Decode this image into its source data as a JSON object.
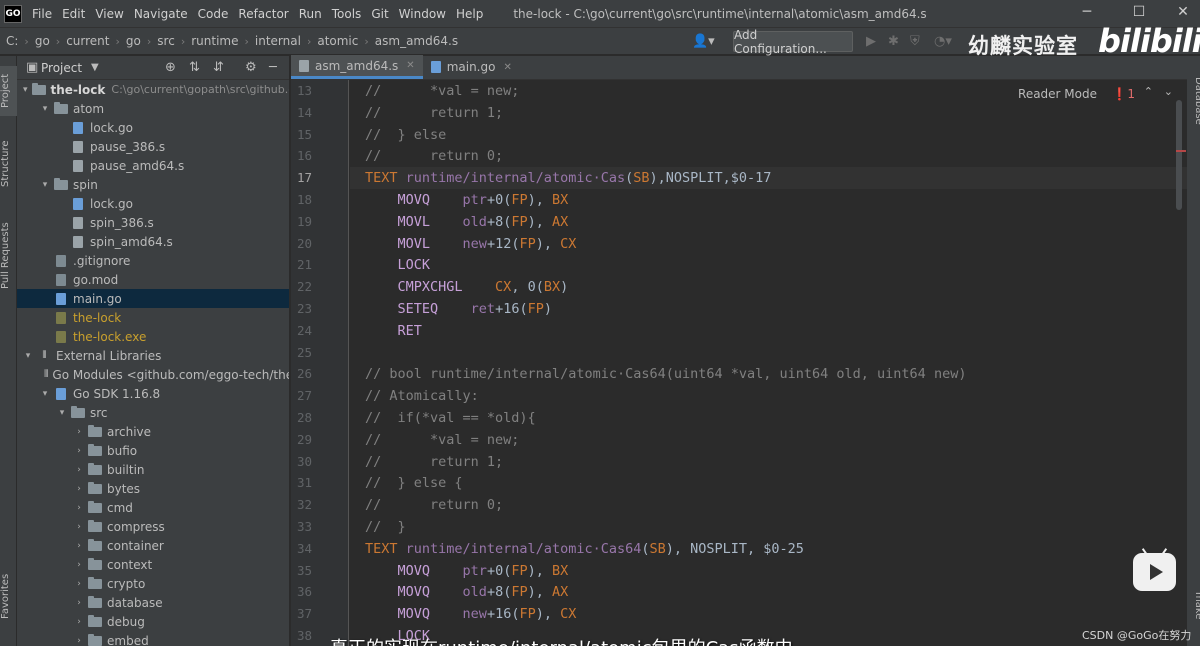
{
  "window": {
    "logo": "GO",
    "title": "the-lock - C:\\go\\current\\go\\src\\runtime\\internal\\atomic\\asm_amd64.s",
    "menu": [
      "File",
      "Edit",
      "View",
      "Navigate",
      "Code",
      "Refactor",
      "Run",
      "Tools",
      "Git",
      "Window",
      "Help"
    ]
  },
  "breadcrumb": [
    "C:",
    "go",
    "current",
    "go",
    "src",
    "runtime",
    "internal",
    "atomic",
    "asm_amd64.s"
  ],
  "toolbar": {
    "run_config_label": "Add Configuration...",
    "icons": [
      "user-icon",
      "run-icon",
      "debug-icon",
      "coverage-icon",
      "profile-icon"
    ]
  },
  "watermark": {
    "channel": "幼麟实验室",
    "site": "bilibili",
    "csdn": "CSDN @GoGo在努力"
  },
  "left_strip": [
    "Project",
    "Structure",
    "Pull Requests",
    "Favorites"
  ],
  "right_strip": [
    "Database",
    "make"
  ],
  "project_panel": {
    "title": "Project",
    "tree": [
      {
        "depth": 0,
        "arrow": "▾",
        "icon": "folder",
        "label": "the-lock",
        "path": "C:\\go\\current\\gopath\\src\\github.co",
        "bold": true
      },
      {
        "depth": 1,
        "arrow": "▾",
        "icon": "folder",
        "label": "atom"
      },
      {
        "depth": 2,
        "arrow": "",
        "icon": "go",
        "label": "lock.go"
      },
      {
        "depth": 2,
        "arrow": "",
        "icon": "s",
        "label": "pause_386.s"
      },
      {
        "depth": 2,
        "arrow": "",
        "icon": "s",
        "label": "pause_amd64.s"
      },
      {
        "depth": 1,
        "arrow": "▾",
        "icon": "folder",
        "label": "spin"
      },
      {
        "depth": 2,
        "arrow": "",
        "icon": "go",
        "label": "lock.go"
      },
      {
        "depth": 2,
        "arrow": "",
        "icon": "s",
        "label": "spin_386.s"
      },
      {
        "depth": 2,
        "arrow": "",
        "icon": "s",
        "label": "spin_amd64.s"
      },
      {
        "depth": 1,
        "arrow": "",
        "icon": "git",
        "label": ".gitignore"
      },
      {
        "depth": 1,
        "arrow": "",
        "icon": "mod",
        "label": "go.mod"
      },
      {
        "depth": 1,
        "arrow": "",
        "icon": "go",
        "label": "main.go",
        "selected": true
      },
      {
        "depth": 1,
        "arrow": "",
        "icon": "bin",
        "label": "the-lock",
        "yellow": true
      },
      {
        "depth": 1,
        "arrow": "",
        "icon": "bin",
        "label": "the-lock.exe",
        "yellow": true
      },
      {
        "depth": 0,
        "arrow": "▾",
        "icon": "lib",
        "label": "External Libraries"
      },
      {
        "depth": 1,
        "arrow": "",
        "icon": "lib",
        "label": "Go Modules <github.com/eggo-tech/the-l"
      },
      {
        "depth": 1,
        "arrow": "▾",
        "icon": "go",
        "label": "Go SDK 1.16.8"
      },
      {
        "depth": 2,
        "arrow": "▾",
        "icon": "folder",
        "label": "src"
      },
      {
        "depth": 3,
        "arrow": "›",
        "icon": "folder",
        "label": "archive"
      },
      {
        "depth": 3,
        "arrow": "›",
        "icon": "folder",
        "label": "bufio"
      },
      {
        "depth": 3,
        "arrow": "›",
        "icon": "folder",
        "label": "builtin"
      },
      {
        "depth": 3,
        "arrow": "›",
        "icon": "folder",
        "label": "bytes"
      },
      {
        "depth": 3,
        "arrow": "›",
        "icon": "folder",
        "label": "cmd"
      },
      {
        "depth": 3,
        "arrow": "›",
        "icon": "folder",
        "label": "compress"
      },
      {
        "depth": 3,
        "arrow": "›",
        "icon": "folder",
        "label": "container"
      },
      {
        "depth": 3,
        "arrow": "›",
        "icon": "folder",
        "label": "context"
      },
      {
        "depth": 3,
        "arrow": "›",
        "icon": "folder",
        "label": "crypto"
      },
      {
        "depth": 3,
        "arrow": "›",
        "icon": "folder",
        "label": "database"
      },
      {
        "depth": 3,
        "arrow": "›",
        "icon": "folder",
        "label": "debug"
      },
      {
        "depth": 3,
        "arrow": "›",
        "icon": "folder",
        "label": "embed"
      }
    ]
  },
  "tabs": [
    {
      "label": "asm_amd64.s",
      "icon": "s",
      "active": true
    },
    {
      "label": "main.go",
      "icon": "go",
      "active": false
    }
  ],
  "editor": {
    "reader_mode": "Reader Mode",
    "error_count": "❗1",
    "current_line": 17,
    "lines": [
      {
        "n": 13,
        "tokens": [
          [
            "c-comment",
            "//      *val = new;"
          ]
        ]
      },
      {
        "n": 14,
        "tokens": [
          [
            "c-comment",
            "//      return 1;"
          ]
        ]
      },
      {
        "n": 15,
        "tokens": [
          [
            "c-comment",
            "//  } else"
          ]
        ]
      },
      {
        "n": 16,
        "tokens": [
          [
            "c-comment",
            "//      return 0;"
          ]
        ]
      },
      {
        "n": 17,
        "tokens": [
          [
            "c-kw",
            "TEXT "
          ],
          [
            "c-sym",
            "runtime∕internal∕atomic·Cas"
          ],
          [
            "c-plain",
            "("
          ],
          [
            "c-sb",
            "SB"
          ],
          [
            "c-plain",
            "),NOSPLIT,$0-17"
          ]
        ]
      },
      {
        "n": 18,
        "tokens": [
          [
            "c-ins",
            "    MOVQ    "
          ],
          [
            "c-sym",
            "ptr"
          ],
          [
            "c-plain",
            "+0("
          ],
          [
            "c-sb",
            "FP"
          ],
          [
            "c-plain",
            "), "
          ],
          [
            "c-reg",
            "BX"
          ]
        ]
      },
      {
        "n": 19,
        "tokens": [
          [
            "c-ins",
            "    MOVL    "
          ],
          [
            "c-sym",
            "old"
          ],
          [
            "c-plain",
            "+8("
          ],
          [
            "c-sb",
            "FP"
          ],
          [
            "c-plain",
            "), "
          ],
          [
            "c-reg",
            "AX"
          ]
        ]
      },
      {
        "n": 20,
        "tokens": [
          [
            "c-ins",
            "    MOVL    "
          ],
          [
            "c-sym",
            "new"
          ],
          [
            "c-plain",
            "+12("
          ],
          [
            "c-sb",
            "FP"
          ],
          [
            "c-plain",
            "), "
          ],
          [
            "c-reg",
            "CX"
          ]
        ]
      },
      {
        "n": 21,
        "tokens": [
          [
            "c-ins",
            "    LOCK"
          ]
        ]
      },
      {
        "n": 22,
        "tokens": [
          [
            "c-ins",
            "    CMPXCHGL    "
          ],
          [
            "c-reg",
            "CX"
          ],
          [
            "c-plain",
            ", 0("
          ],
          [
            "c-reg",
            "BX"
          ],
          [
            "c-plain",
            ")"
          ]
        ]
      },
      {
        "n": 23,
        "tokens": [
          [
            "c-ins",
            "    SETEQ    "
          ],
          [
            "c-sym",
            "ret"
          ],
          [
            "c-plain",
            "+16("
          ],
          [
            "c-sb",
            "FP"
          ],
          [
            "c-plain",
            ")"
          ]
        ]
      },
      {
        "n": 24,
        "tokens": [
          [
            "c-ins",
            "    RET"
          ]
        ]
      },
      {
        "n": 25,
        "tokens": [
          [
            "c-plain",
            ""
          ]
        ]
      },
      {
        "n": 26,
        "tokens": [
          [
            "c-comment",
            "// bool runtime∕internal∕atomic·Cas64(uint64 *val, uint64 old, uint64 new)"
          ]
        ]
      },
      {
        "n": 27,
        "tokens": [
          [
            "c-comment",
            "// Atomically:"
          ]
        ]
      },
      {
        "n": 28,
        "tokens": [
          [
            "c-comment",
            "//  if(*val == *old){"
          ]
        ]
      },
      {
        "n": 29,
        "tokens": [
          [
            "c-comment",
            "//      *val = new;"
          ]
        ]
      },
      {
        "n": 30,
        "tokens": [
          [
            "c-comment",
            "//      return 1;"
          ]
        ]
      },
      {
        "n": 31,
        "tokens": [
          [
            "c-comment",
            "//  } else {"
          ]
        ]
      },
      {
        "n": 32,
        "tokens": [
          [
            "c-comment",
            "//      return 0;"
          ]
        ]
      },
      {
        "n": 33,
        "tokens": [
          [
            "c-comment",
            "//  }"
          ]
        ]
      },
      {
        "n": 34,
        "tokens": [
          [
            "c-kw",
            "TEXT "
          ],
          [
            "c-sym",
            "runtime∕internal∕atomic·Cas64"
          ],
          [
            "c-plain",
            "("
          ],
          [
            "c-sb",
            "SB"
          ],
          [
            "c-plain",
            "), NOSPLIT, $0-25"
          ]
        ]
      },
      {
        "n": 35,
        "tokens": [
          [
            "c-ins",
            "    MOVQ    "
          ],
          [
            "c-sym",
            "ptr"
          ],
          [
            "c-plain",
            "+0("
          ],
          [
            "c-sb",
            "FP"
          ],
          [
            "c-plain",
            "), "
          ],
          [
            "c-reg",
            "BX"
          ]
        ]
      },
      {
        "n": 36,
        "tokens": [
          [
            "c-ins",
            "    MOVQ    "
          ],
          [
            "c-sym",
            "old"
          ],
          [
            "c-plain",
            "+8("
          ],
          [
            "c-sb",
            "FP"
          ],
          [
            "c-plain",
            "), "
          ],
          [
            "c-reg",
            "AX"
          ]
        ]
      },
      {
        "n": 37,
        "tokens": [
          [
            "c-ins",
            "    MOVQ    "
          ],
          [
            "c-sym",
            "new"
          ],
          [
            "c-plain",
            "+16("
          ],
          [
            "c-sb",
            "FP"
          ],
          [
            "c-plain",
            "), "
          ],
          [
            "c-reg",
            "CX"
          ]
        ]
      },
      {
        "n": 38,
        "tokens": [
          [
            "c-ins",
            "    LOCK"
          ]
        ]
      }
    ]
  },
  "subtitle": "真正的实现在runtime/internal/atomic包里的Cas函数中"
}
